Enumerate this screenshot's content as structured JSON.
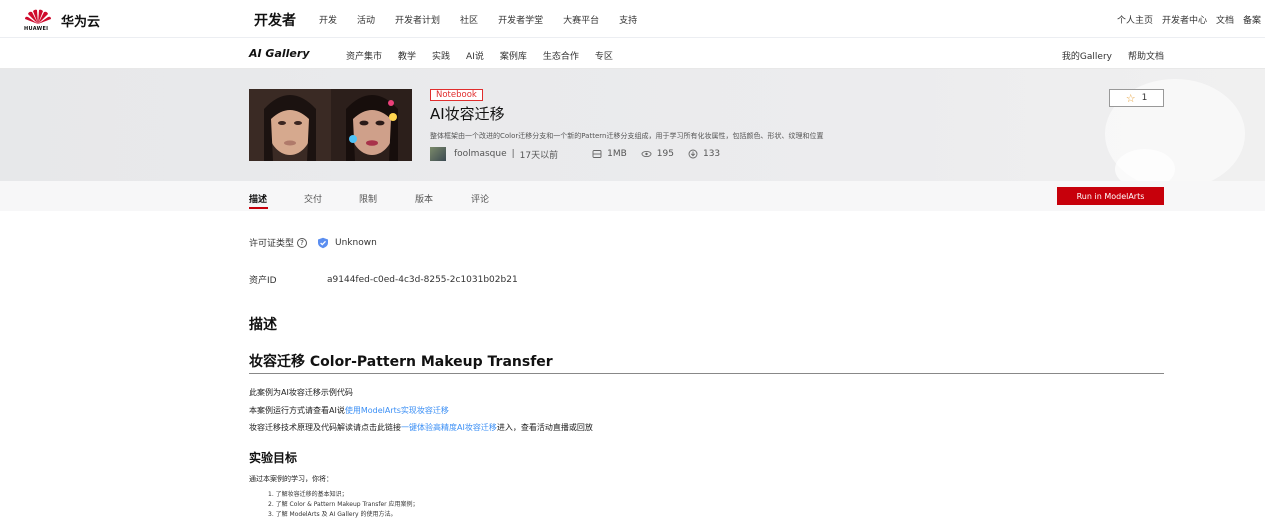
{
  "topnav": {
    "brand_logo_text": "HUAWEI",
    "brand_name": "华为云",
    "dev_title": "开发者",
    "menu": [
      "开发",
      "活动",
      "开发者计划",
      "社区",
      "开发者学堂",
      "大赛平台",
      "支持"
    ],
    "right": [
      "个人主页",
      "开发者中心",
      "文档",
      "备案"
    ]
  },
  "subnav": {
    "title": "AI Gallery",
    "menu": [
      "资产集市",
      "教学",
      "实践",
      "AI说",
      "案例库",
      "生态合作",
      "专区"
    ],
    "right": [
      "我的Gallery",
      "帮助文档"
    ]
  },
  "asset": {
    "badge": "Notebook",
    "title": "AI妆容迁移",
    "description": "整体框架由一个改进的Color迁移分支和一个新的Pattern迁移分支组成，用于学习所有化妆属性，包括颜色、形状、纹理和位置",
    "author": "foolmasque",
    "time": "17天以前",
    "separator": "|",
    "size": "1MB",
    "views": "195",
    "downloads": "133",
    "star_count": "1"
  },
  "tabs": {
    "items": [
      "描述",
      "交付",
      "限制",
      "版本",
      "评论"
    ],
    "run_button": "Run in ModelArts"
  },
  "details": {
    "license_label": "许可证类型",
    "license_value": "Unknown",
    "asset_id_label": "资产ID",
    "asset_id_value": "a9144fed-c0ed-4c3d-8255-2c1031b02b21"
  },
  "content": {
    "desc_heading": "描述",
    "main_heading": "妆容迁移 Color-Pattern Makeup Transfer",
    "p1": "此案例为AI妆容迁移示例代码",
    "p2_prefix": "本案例运行方式请查看AI说",
    "p2_link": "使用ModelArts实现妆容迁移",
    "p3_prefix": "妆容迁移技术原理及代码解读请点击此链接",
    "p3_link": "一键体验高精度AI妆容迁移",
    "p3_suffix": "进入，查看活动直播或回放",
    "goal_heading": "实验目标",
    "goal_intro": "通过本案例的学习，你将：",
    "goals": [
      "1. 了解妆容迁移的基本知识；",
      "2. 了解 Color & Pattern Makeup Transfer 应用案例；",
      "3. 了解 ModelArts 及 AI Gallery 的使用方法。"
    ]
  },
  "colors": {
    "brand_red": "#c7000b",
    "link_blue": "#3b8ff5",
    "badge_red": "#e02d2d",
    "shield_blue": "#5b8ef0"
  }
}
